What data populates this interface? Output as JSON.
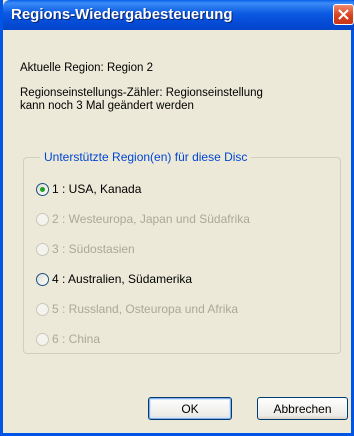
{
  "window": {
    "title": "Regions-Wiedergabesteuerung"
  },
  "info": {
    "current_region": "Aktuelle Region: Region 2",
    "counter_line1": "Regionseinstellungs-Zähler: Regionseinstellung",
    "counter_line2": "kann noch 3 Mal geändert werden"
  },
  "group": {
    "title": "Unterstützte Region(en) für diese Disc",
    "options": [
      {
        "label": "1 : USA, Kanada",
        "enabled": true,
        "selected": true
      },
      {
        "label": "2 : Westeuropa, Japan und Südafrika",
        "enabled": false,
        "selected": false
      },
      {
        "label": "3 : Südostasien",
        "enabled": false,
        "selected": false
      },
      {
        "label": "4 : Australien, Südamerika",
        "enabled": true,
        "selected": false
      },
      {
        "label": "5 : Russland, Osteuropa und Afrika",
        "enabled": false,
        "selected": false
      },
      {
        "label": "6 : China",
        "enabled": false,
        "selected": false
      }
    ]
  },
  "buttons": {
    "ok": "OK",
    "cancel": "Abbrechen"
  }
}
